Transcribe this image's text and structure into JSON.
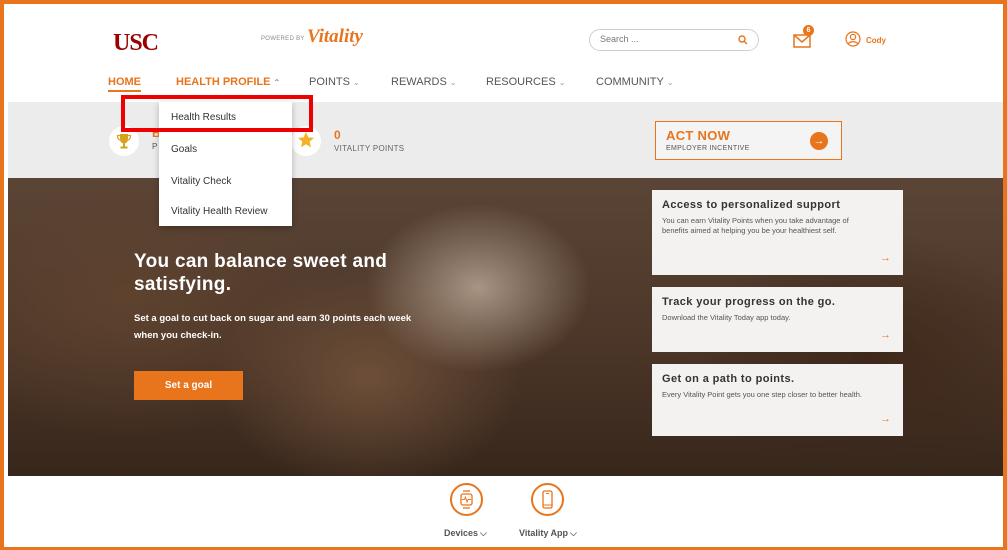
{
  "header": {
    "logo_text": "USC",
    "powered_by": "POWERED BY",
    "vitality_logo": "Vitality",
    "search_placeholder": "Search ...",
    "notification_count": "6",
    "user_name": "Cody"
  },
  "nav": {
    "home": "HOME",
    "health_profile": "HEALTH PROFILE",
    "points": "POINTS",
    "rewards": "REWARDS",
    "resources": "RESOURCES",
    "community": "COMMUNITY",
    "chevron": "⌄"
  },
  "health_profile_menu": {
    "items": [
      "Health Results",
      "Goals",
      "Vitality Check",
      "Vitality Health Review"
    ],
    "highlighted_item": "Health Results"
  },
  "status_band": {
    "status_number_partial": "B",
    "status_label_partial": "P",
    "points_value": "0",
    "points_label": "VITALITY POINTS",
    "act_now_title": "ACT NOW",
    "act_now_sub": "EMPLOYER INCENTIVE",
    "act_now_arrow": "→"
  },
  "hero": {
    "title": "You can balance sweet and satisfying.",
    "text": "Set a goal to cut back on sugar and earn 30 points each week when you check-in.",
    "button_label": "Set a goal"
  },
  "cards": [
    {
      "title": "Access to personalized support",
      "text": "You can earn Vitality Points when you take advantage of benefits aimed at helping you be your healthiest self.",
      "arrow": "→"
    },
    {
      "title": "Track your progress on the go.",
      "text": "Download the Vitality Today app today.",
      "arrow": "→"
    },
    {
      "title": "Get on a path to points.",
      "text": "Every Vitality Point gets you one step closer to better health.",
      "arrow": "→"
    }
  ],
  "bottom": {
    "devices_label": "Devices",
    "app_label": "Vitality App",
    "chevron": "⌵"
  },
  "colors": {
    "accent": "#e8741c",
    "usc_red": "#990000",
    "highlight_box": "#ee0000"
  }
}
